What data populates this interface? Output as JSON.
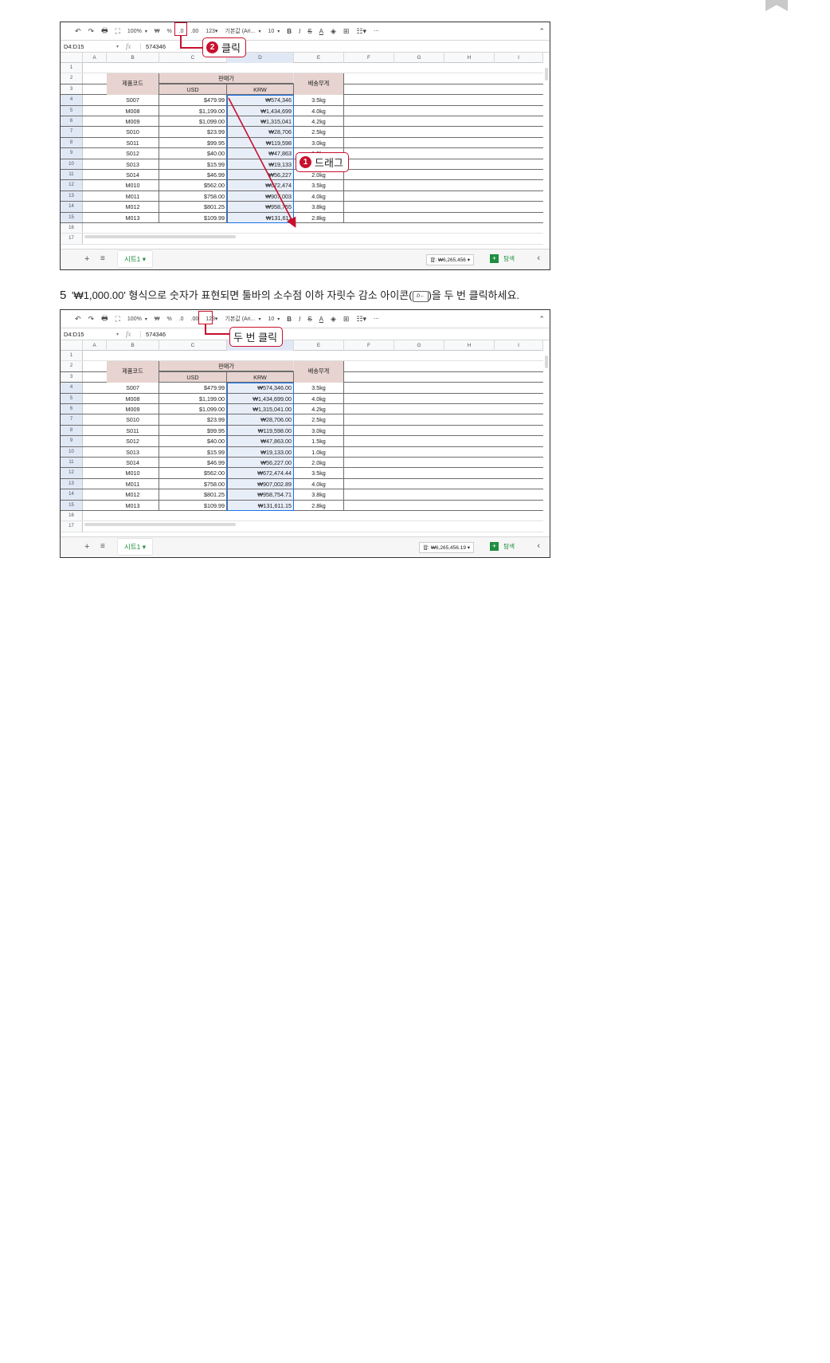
{
  "toolbar": {
    "undo": "↶",
    "redo": "↷",
    "print": "🖶",
    "paint": "⛶",
    "zoom": "100%",
    "dropdown_caret": "▾",
    "currency": "₩",
    "percent": "%",
    "decrease_decimal": ".0",
    "increase_decimal": ".00",
    "more_formats": "123▾",
    "font": "기본값 (Ari...",
    "font_size": "10",
    "bold": "B",
    "italic": "I",
    "strikethrough": "S",
    "text_color": "A",
    "fill": "◈",
    "borders": "⊞",
    "merge": "☷▾",
    "more": "⋯",
    "collapse": "⌃"
  },
  "screenshot1": {
    "name_box": "D4:D15",
    "formula_value": "574346",
    "columns": [
      "A",
      "B",
      "C",
      "D",
      "E",
      "F",
      "G",
      "H",
      "I"
    ],
    "row_numbers": [
      "1",
      "2",
      "3",
      "4",
      "5",
      "6",
      "7",
      "8",
      "9",
      "10",
      "11",
      "12",
      "13",
      "14",
      "15",
      "16",
      "17"
    ],
    "header": {
      "group": "판매가",
      "code": "제품코드",
      "usd": "USD",
      "krw": "KRW",
      "weight": "배송무게"
    },
    "rows": [
      {
        "code": "S007",
        "usd": "$479.99",
        "krw": "₩574,346",
        "weight": "3.5kg"
      },
      {
        "code": "M008",
        "usd": "$1,199.00",
        "krw": "₩1,434,699",
        "weight": "4.0kg"
      },
      {
        "code": "M009",
        "usd": "$1,099.00",
        "krw": "₩1,315,041",
        "weight": "4.2kg"
      },
      {
        "code": "S010",
        "usd": "$23.99",
        "krw": "₩28,706",
        "weight": "2.5kg"
      },
      {
        "code": "S011",
        "usd": "$99.95",
        "krw": "₩119,598",
        "weight": "3.0kg"
      },
      {
        "code": "S012",
        "usd": "$40.00",
        "krw": "₩47,863",
        "weight": "1.5kg"
      },
      {
        "code": "S013",
        "usd": "$15.99",
        "krw": "₩19,133",
        "weight": "1.0kg"
      },
      {
        "code": "S014",
        "usd": "$46.99",
        "krw": "₩56,227",
        "weight": "2.0kg"
      },
      {
        "code": "M010",
        "usd": "$562.00",
        "krw": "₩672,474",
        "weight": "3.5kg"
      },
      {
        "code": "M011",
        "usd": "$758.00",
        "krw": "₩907,003",
        "weight": "4.0kg"
      },
      {
        "code": "M012",
        "usd": "$801.25",
        "krw": "₩958,755",
        "weight": "3.8kg"
      },
      {
        "code": "M013",
        "usd": "$109.99",
        "krw": "₩131,611",
        "weight": "2.8kg"
      }
    ],
    "sheet_tab": "시트1 ▾",
    "sum": "합: ₩6,265,456 ▾",
    "explore": "탐색",
    "callout_drag": {
      "badge": "1",
      "text": "드래그"
    },
    "callout_click": {
      "badge": "2",
      "text": "클릭"
    }
  },
  "caption": {
    "number": "5",
    "before_icon": "'₩1,000.00' 형식으로 숫자가 표현되면 툴바의 소수점 이하 자릿수 감소 아이콘(",
    "icon_text": ".0←",
    "after_icon": ")을 두 번 클릭하세요."
  },
  "screenshot2": {
    "name_box": "D4:D15",
    "formula_value": "574346",
    "rows": [
      {
        "code": "S007",
        "usd": "$479.99",
        "krw": "₩574,346.00",
        "weight": "3.5kg"
      },
      {
        "code": "M008",
        "usd": "$1,199.00",
        "krw": "₩1,434,699.00",
        "weight": "4.0kg"
      },
      {
        "code": "M009",
        "usd": "$1,099.00",
        "krw": "₩1,315,041.00",
        "weight": "4.2kg"
      },
      {
        "code": "S010",
        "usd": "$23.99",
        "krw": "₩28,706.00",
        "weight": "2.5kg"
      },
      {
        "code": "S011",
        "usd": "$99.95",
        "krw": "₩119,598.00",
        "weight": "3.0kg"
      },
      {
        "code": "S012",
        "usd": "$40.00",
        "krw": "₩47,863.00",
        "weight": "1.5kg"
      },
      {
        "code": "S013",
        "usd": "$15.99",
        "krw": "₩19,133.00",
        "weight": "1.0kg"
      },
      {
        "code": "S014",
        "usd": "$46.99",
        "krw": "₩56,227.00",
        "weight": "2.0kg"
      },
      {
        "code": "M010",
        "usd": "$562.00",
        "krw": "₩672,474.44",
        "weight": "3.5kg"
      },
      {
        "code": "M011",
        "usd": "$758.00",
        "krw": "₩907,002.89",
        "weight": "4.0kg"
      },
      {
        "code": "M012",
        "usd": "$801.25",
        "krw": "₩958,754.71",
        "weight": "3.8kg"
      },
      {
        "code": "M013",
        "usd": "$109.99",
        "krw": "₩131,611.15",
        "weight": "2.8kg"
      }
    ],
    "sheet_tab": "시트1 ▾",
    "sum": "합: ₩6,265,456.19 ▾",
    "explore": "탐색",
    "callout_click_twice": {
      "text": "두 번 클릭"
    }
  },
  "colors": {
    "accent_red": "#c8102e",
    "header_fill": "#e7d3d0",
    "selection_fill": "#e8eef8",
    "sheets_green": "#1e8e3e"
  }
}
